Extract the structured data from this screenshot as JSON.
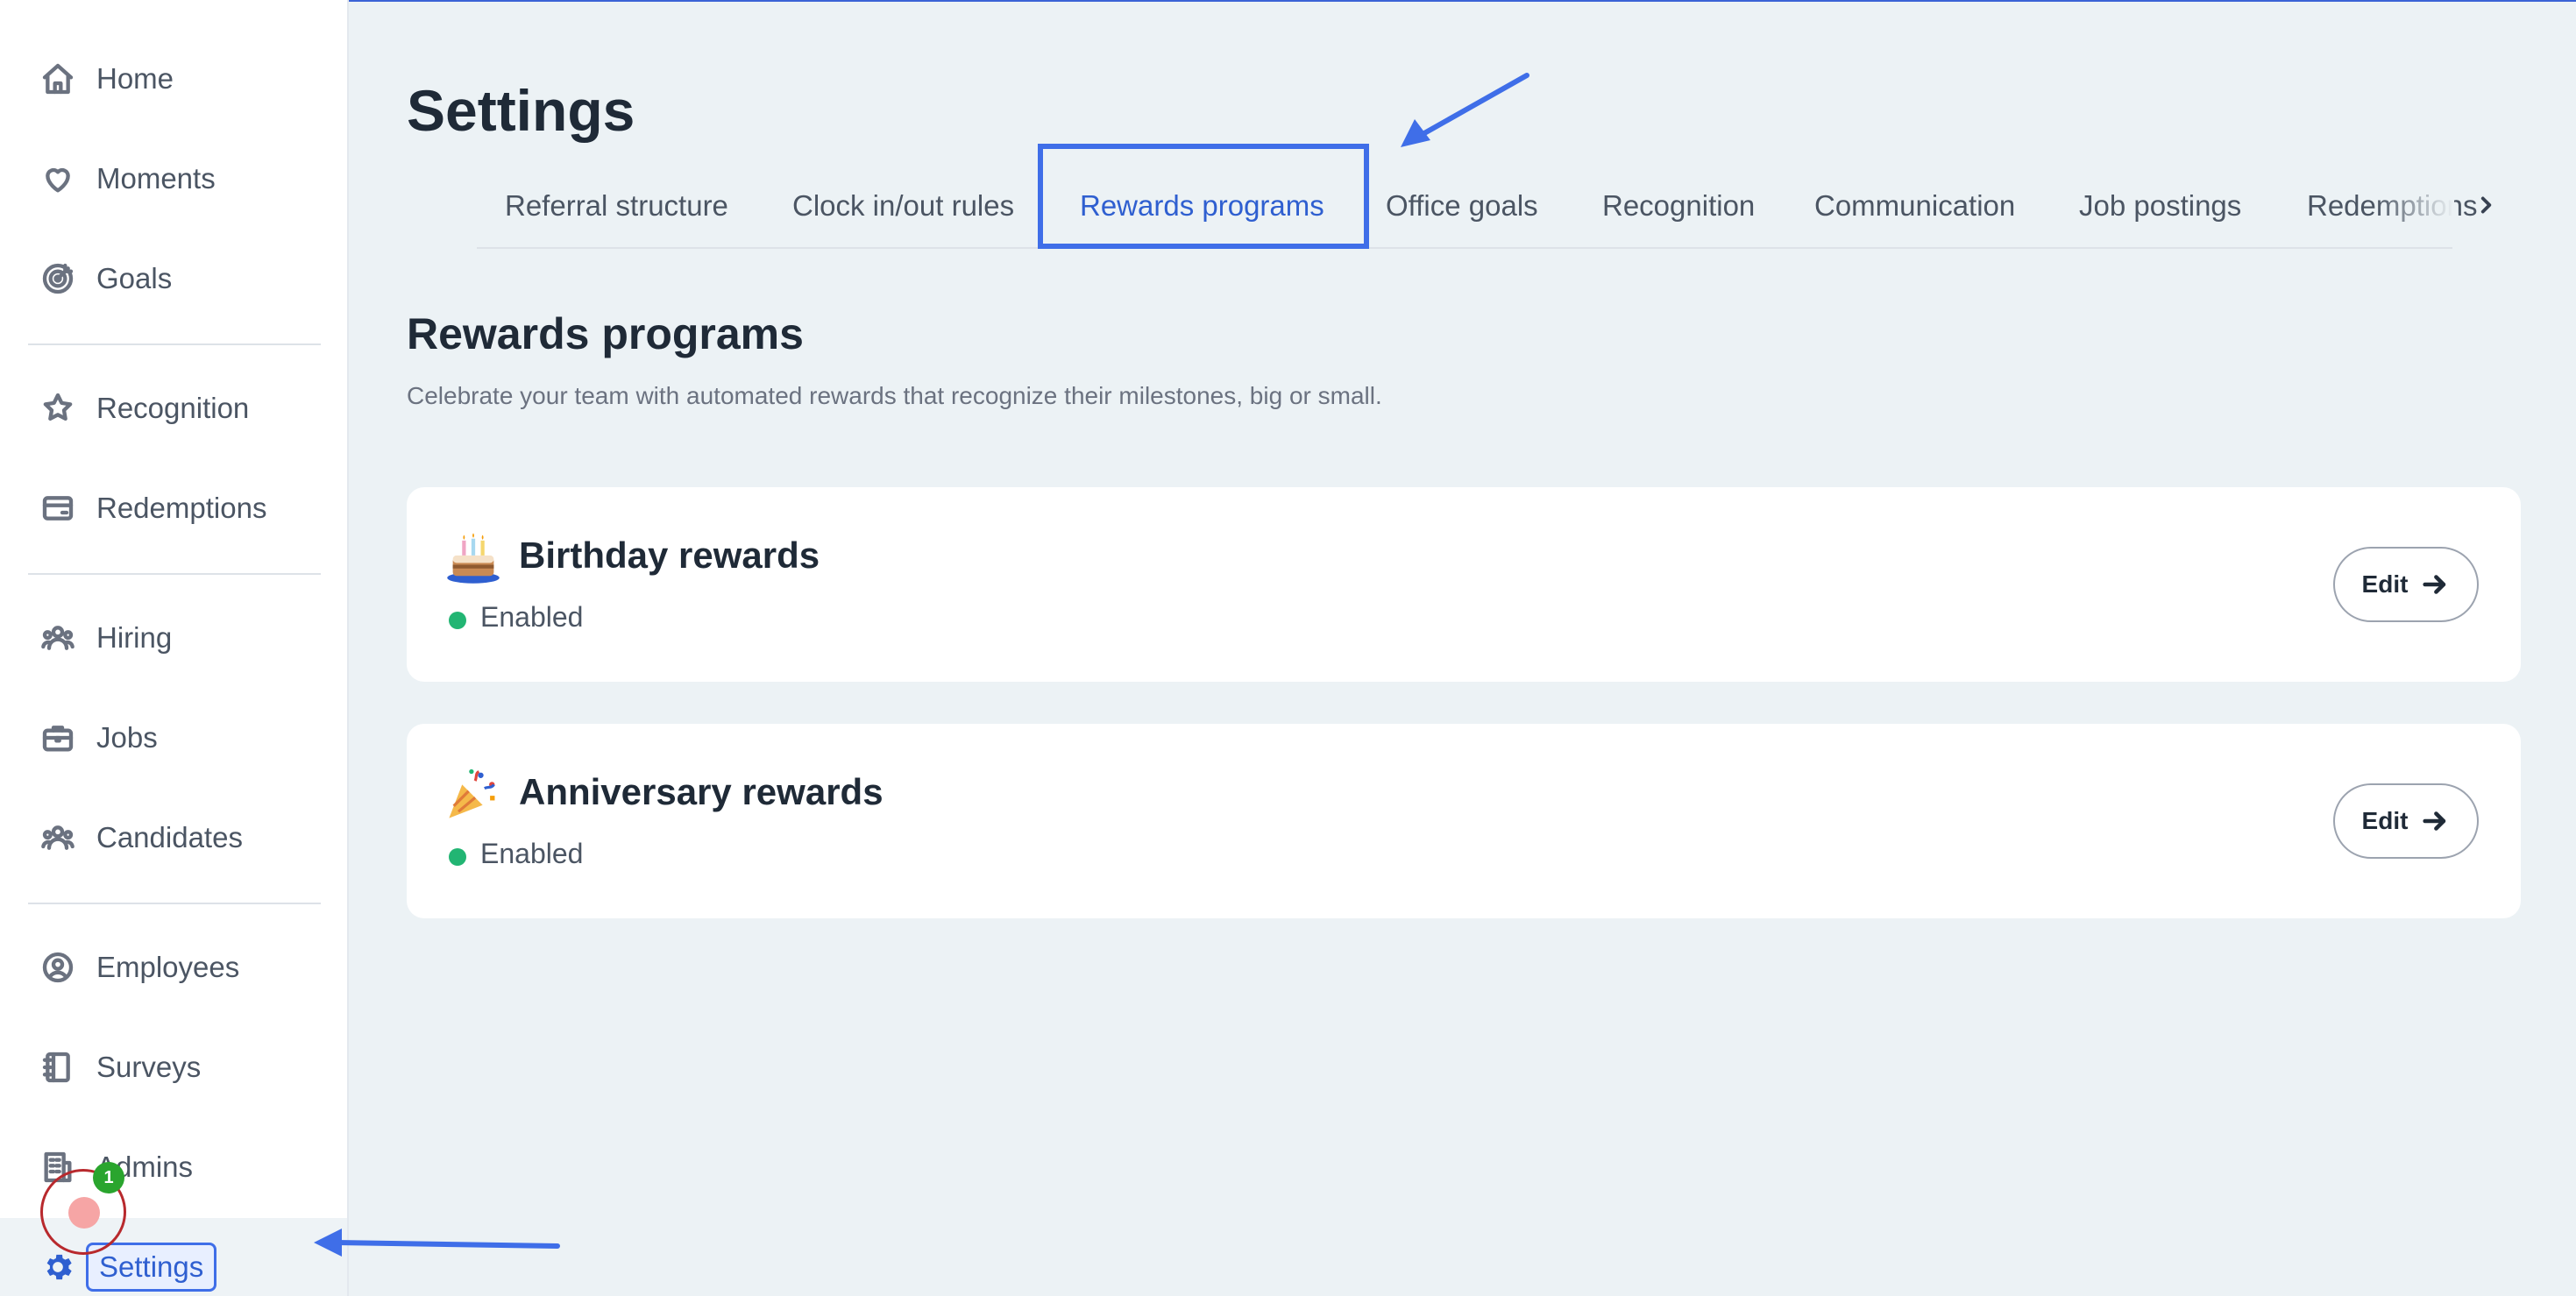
{
  "sidebar": {
    "items": [
      {
        "label": "Home",
        "icon": "home-icon"
      },
      {
        "label": "Moments",
        "icon": "heart-icon"
      },
      {
        "label": "Goals",
        "icon": "target-icon"
      },
      {
        "label": "Recognition",
        "icon": "star-badge-icon"
      },
      {
        "label": "Redemptions",
        "icon": "credit-card-icon"
      },
      {
        "label": "Hiring",
        "icon": "people-icon"
      },
      {
        "label": "Jobs",
        "icon": "briefcase-icon"
      },
      {
        "label": "Candidates",
        "icon": "people-icon"
      },
      {
        "label": "Employees",
        "icon": "user-circle-icon"
      },
      {
        "label": "Surveys",
        "icon": "notebook-icon"
      },
      {
        "label": "Admins",
        "icon": "building-icon"
      }
    ],
    "settings": {
      "label": "Settings",
      "icon": "gear-icon"
    },
    "cursor_badge": "1"
  },
  "header": {
    "title": "Settings"
  },
  "tabs": [
    {
      "label": "Referral structure"
    },
    {
      "label": "Clock in/out rules"
    },
    {
      "label": "Rewards programs",
      "active": true
    },
    {
      "label": "Office goals"
    },
    {
      "label": "Recognition"
    },
    {
      "label": "Communication"
    },
    {
      "label": "Job postings"
    },
    {
      "label": "Redemptions"
    }
  ],
  "section": {
    "title": "Rewards programs",
    "description": "Celebrate your team with automated rewards that recognize their milestones, big or small."
  },
  "cards": [
    {
      "title": "Birthday rewards",
      "status": "Enabled",
      "emoji": "birthday-cake-icon",
      "button": "Edit"
    },
    {
      "title": "Anniversary rewards",
      "status": "Enabled",
      "emoji": "party-popper-icon",
      "button": "Edit"
    }
  ],
  "colors": {
    "accent": "#2f5fd0",
    "highlight": "#3f6ee8",
    "enabled": "#22b573",
    "background": "#ecf2f5"
  }
}
